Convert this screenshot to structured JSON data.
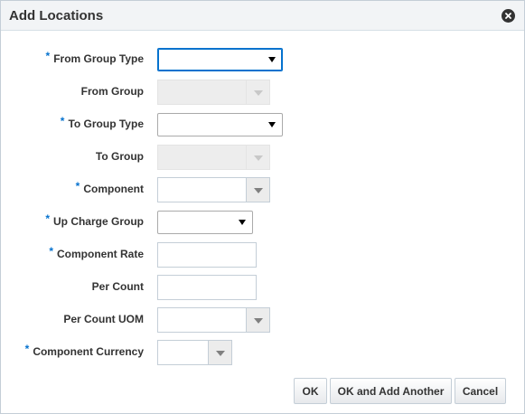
{
  "dialog": {
    "title": "Add Locations",
    "close_icon": "close-icon"
  },
  "form": {
    "required_marker": "*",
    "from_group_type": {
      "label": "From Group Type",
      "value": ""
    },
    "from_group": {
      "label": "From Group",
      "value": ""
    },
    "to_group_type": {
      "label": "To Group Type",
      "value": ""
    },
    "to_group": {
      "label": "To Group",
      "value": ""
    },
    "component": {
      "label": "Component",
      "value": ""
    },
    "up_charge_group": {
      "label": "Up Charge Group",
      "value": ""
    },
    "component_rate": {
      "label": "Component Rate",
      "value": ""
    },
    "per_count": {
      "label": "Per Count",
      "value": ""
    },
    "per_count_uom": {
      "label": "Per Count UOM",
      "value": ""
    },
    "component_currency": {
      "label": "Component Currency",
      "value": ""
    }
  },
  "buttons": {
    "ok": "OK",
    "ok_add_another": "OK and Add Another",
    "cancel": "Cancel"
  },
  "colors": {
    "required": "#0572ce",
    "header_bg": "#f2f4f6",
    "text": "#333333"
  }
}
